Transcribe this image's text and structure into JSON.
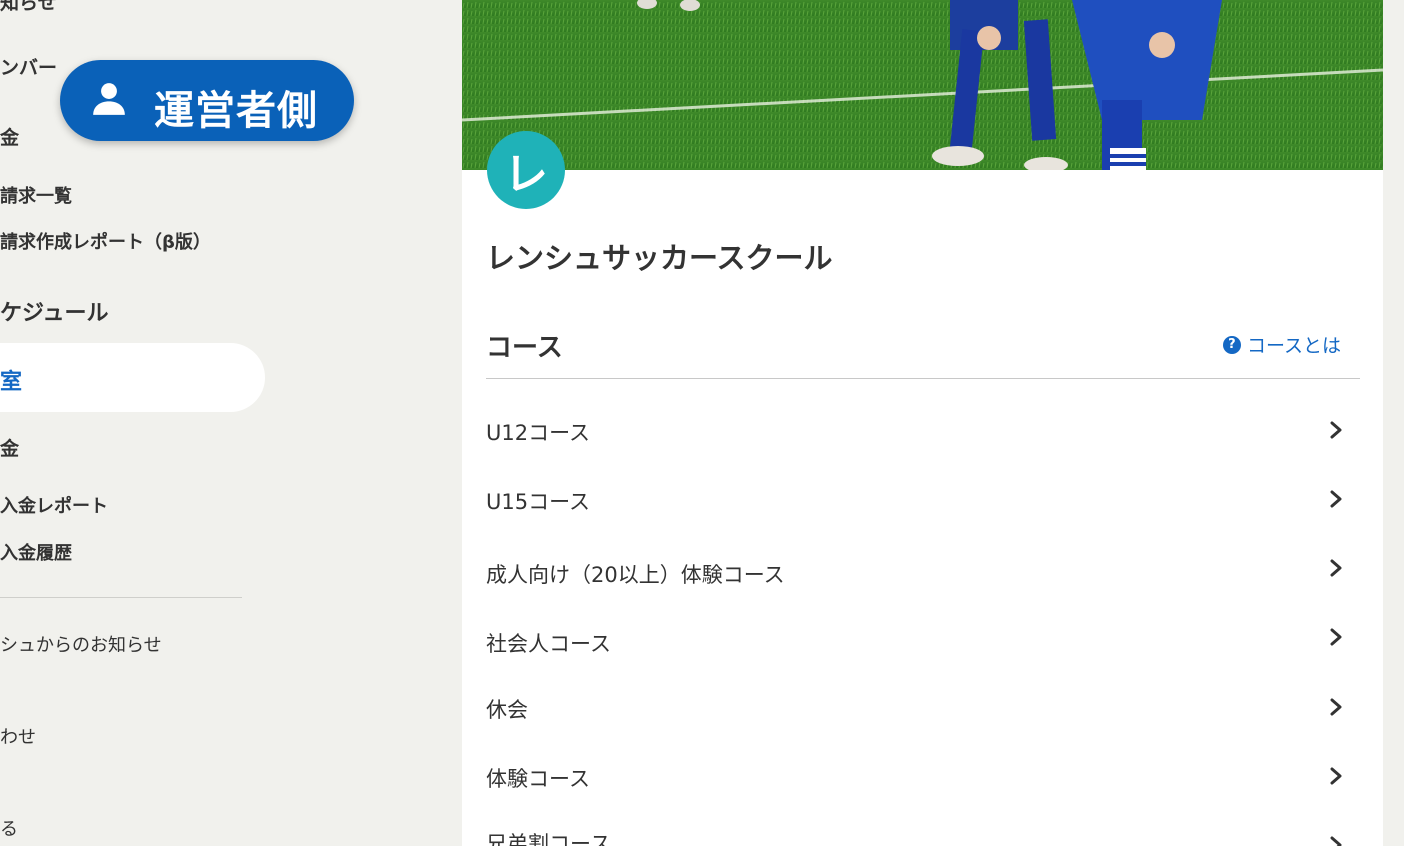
{
  "sidebar": {
    "items": [
      {
        "label": "知らせ"
      },
      {
        "label": "ンバー"
      },
      {
        "label": "金"
      },
      {
        "label": "請求一覧"
      },
      {
        "label": "請求作成レポート（β版）"
      },
      {
        "label": "ケジュール"
      },
      {
        "label": "室"
      },
      {
        "label": "金"
      },
      {
        "label": "入金レポート"
      },
      {
        "label": "入金履歴"
      },
      {
        "label": "シュからのお知らせ"
      },
      {
        "label": "わせ"
      },
      {
        "label": "る"
      }
    ],
    "active_index": 6
  },
  "badge": {
    "icon": "person-icon",
    "label": "運営者側"
  },
  "school": {
    "logo_letter": "レ",
    "name": "レンシュサッカースクール",
    "logo_color": "#1fb2b8"
  },
  "courses": {
    "title": "コース",
    "help_label": "コースとは",
    "help_icon": "question-circle-icon",
    "items": [
      {
        "label": "U12コース"
      },
      {
        "label": "U15コース"
      },
      {
        "label": "成人向け（20以上）体験コース"
      },
      {
        "label": "社会人コース"
      },
      {
        "label": "休会"
      },
      {
        "label": "体験コース"
      },
      {
        "label": "兄弟割コース"
      }
    ]
  },
  "colors": {
    "accent": "#1468c4",
    "badge": "#0a61b8",
    "background": "#f1f1ed"
  }
}
